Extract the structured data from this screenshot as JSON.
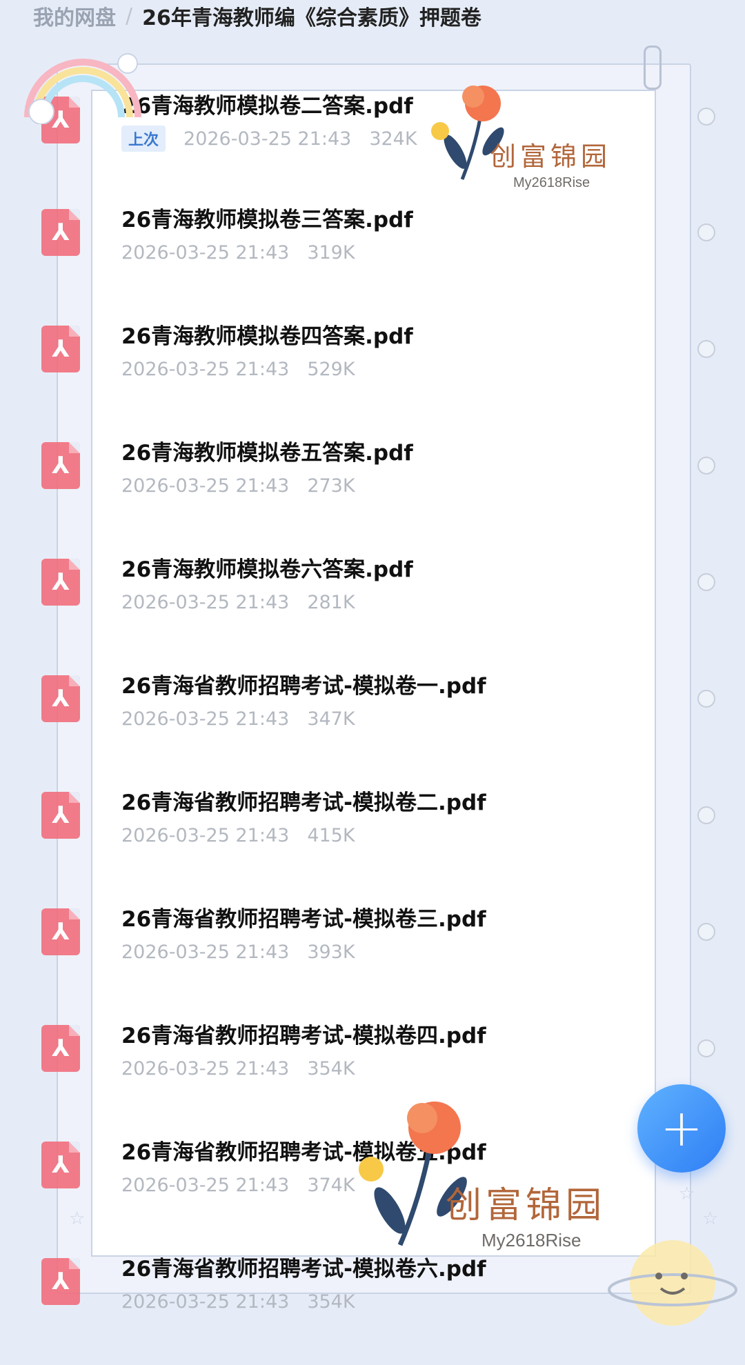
{
  "breadcrumb": {
    "root": "我的网盘",
    "separator": "/",
    "current": "26年青海教师编《综合素质》押题卷"
  },
  "files": [
    {
      "name": "26青海教师模拟卷二答案.pdf",
      "badge": "上次",
      "date": "2026-03-25 21:43",
      "size": "324K"
    },
    {
      "name": "26青海教师模拟卷三答案.pdf",
      "date": "2026-03-25 21:43",
      "size": "319K"
    },
    {
      "name": "26青海教师模拟卷四答案.pdf",
      "date": "2026-03-25 21:43",
      "size": "529K"
    },
    {
      "name": "26青海教师模拟卷五答案.pdf",
      "date": "2026-03-25 21:43",
      "size": "273K"
    },
    {
      "name": "26青海教师模拟卷六答案.pdf",
      "date": "2026-03-25 21:43",
      "size": "281K"
    },
    {
      "name": "26青海省教师招聘考试-模拟卷一.pdf",
      "date": "2026-03-25 21:43",
      "size": "347K"
    },
    {
      "name": "26青海省教师招聘考试-模拟卷二.pdf",
      "date": "2026-03-25 21:43",
      "size": "415K"
    },
    {
      "name": "26青海省教师招聘考试-模拟卷三.pdf",
      "date": "2026-03-25 21:43",
      "size": "393K"
    },
    {
      "name": "26青海省教师招聘考试-模拟卷四.pdf",
      "date": "2026-03-25 21:43",
      "size": "354K"
    },
    {
      "name": "26青海省教师招聘考试-模拟卷五.pdf",
      "date": "2026-03-25 21:43",
      "size": "374K"
    },
    {
      "name": "26青海省教师招聘考试-模拟卷六.pdf",
      "date": "2026-03-25 21:43",
      "size": "354K"
    }
  ],
  "file_icon": "pdf-file-icon",
  "fab": {
    "icon": "plus-icon",
    "label": "+"
  },
  "stickers": [
    {
      "title": "创富锦园",
      "handle": "My2618Rise"
    },
    {
      "title": "创富锦园",
      "handle": "My2618Rise"
    }
  ],
  "colors": {
    "background": "#e6ecf7",
    "pdf_icon": "#f26b7a",
    "fab": "#2f7ef5",
    "meta_text": "#b3b8c0",
    "badge": "#3a78d0",
    "sticker_text": "#b2663a"
  }
}
